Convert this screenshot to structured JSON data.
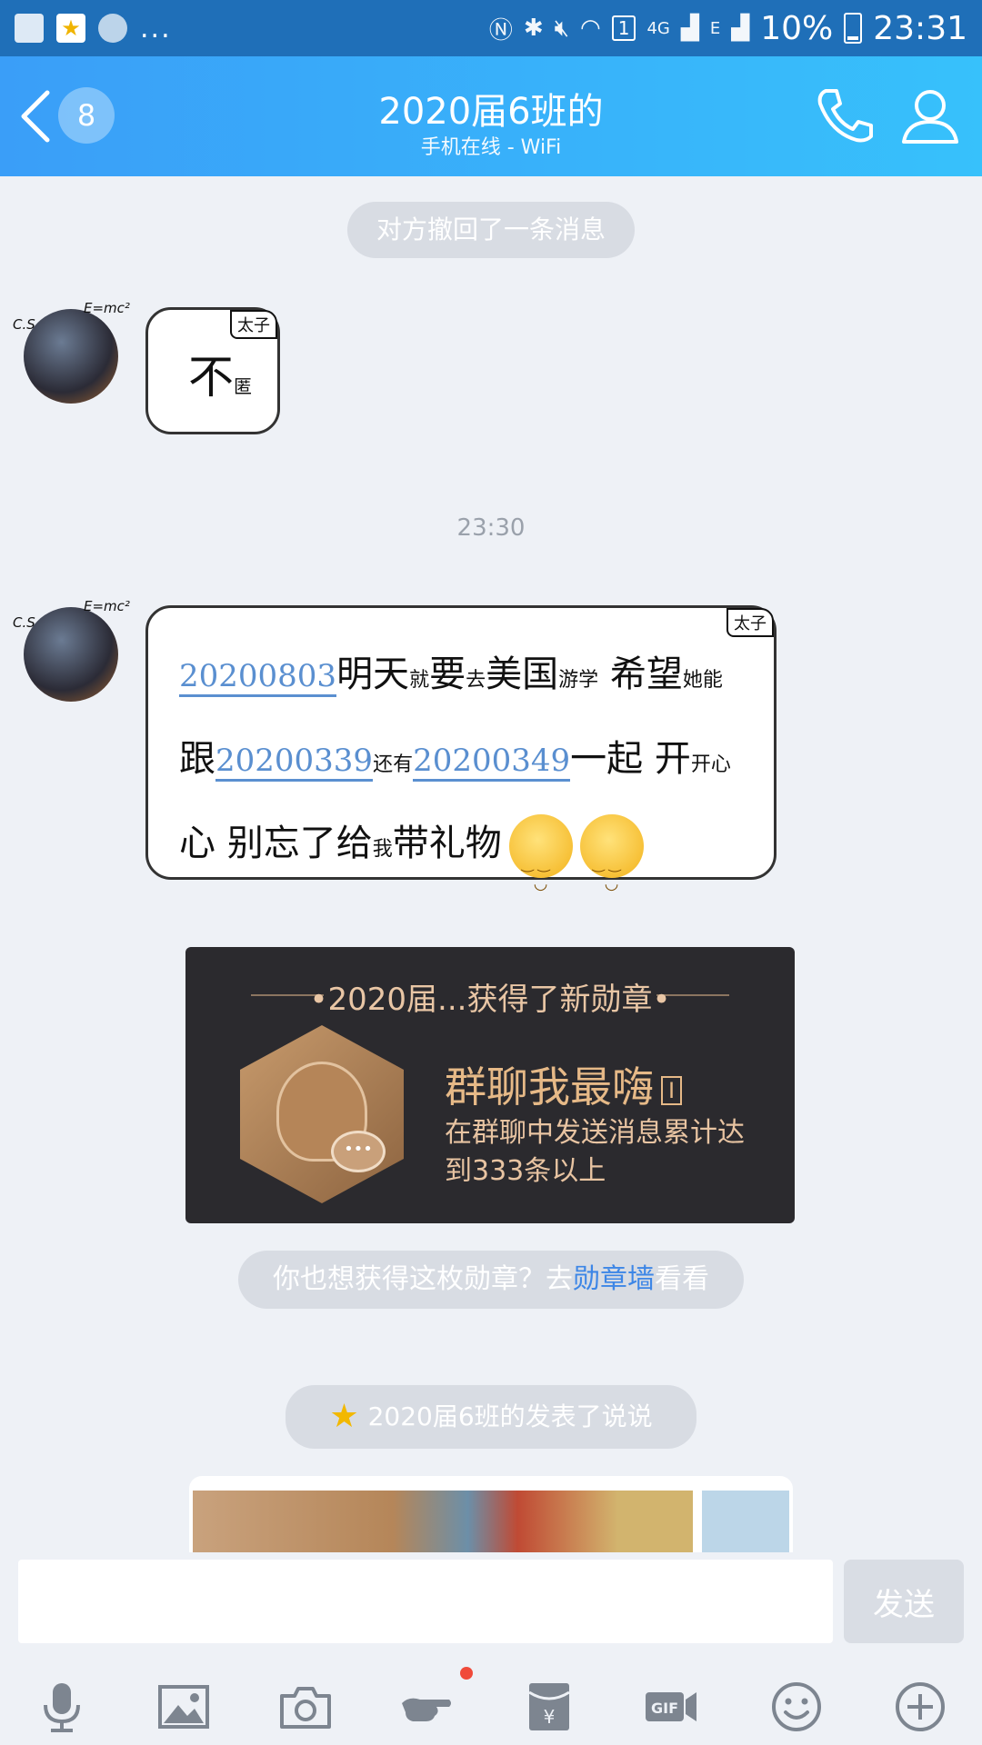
{
  "status_bar": {
    "network_4g": "4G",
    "network_e": "E",
    "sim_slot": "1",
    "battery": "10%",
    "time": "23:31",
    "ellipsis": "..."
  },
  "header": {
    "back_count": "8",
    "title": "2020届6班的",
    "subtitle": "手机在线 - WiFi"
  },
  "chat": {
    "recall_notice": "对方撤回了一条消息",
    "time_divider": "23:30",
    "messages": [
      {
        "sender_tag": "太子",
        "text_main": "不",
        "text_small": "匿"
      },
      {
        "sender_tag": "太子",
        "parts": {
          "num1": "20200803",
          "t1": "明天",
          "t1s": "就",
          "t2": "要",
          "t2s": "去",
          "t3": "美国",
          "t3s": "游学",
          "t4": "希望",
          "t4s": "她能",
          "t5": "跟",
          "num2": "20200339",
          "t5s": "还有",
          "num3": "20200349",
          "t6": "一起",
          "t7": "开",
          "t7s": "开心",
          "t8": "心 别忘了",
          "t9": "给",
          "t9s": "我",
          "t10": "带礼物"
        }
      }
    ]
  },
  "medal_card": {
    "heading": "2020届...获得了新勋章",
    "name": "群聊我最嗨",
    "level": "I",
    "description": "在群聊中发送消息累计达到333条以上"
  },
  "medal_wall_prompt": {
    "prefix": "你也想获得这枚勋章？去",
    "link": "勋章墙",
    "suffix": "看看"
  },
  "post_notice": "2020届6班的发表了说说",
  "input_bar": {
    "send_label": "发送",
    "tools": [
      "mic-icon",
      "image-icon",
      "camera-icon",
      "poke-icon",
      "red-packet-icon",
      "gif-icon",
      "emoji-icon",
      "plus-icon"
    ]
  },
  "colors": {
    "header_start": "#3a9ef8",
    "header_end": "#37c1fb",
    "link": "#3d86e6",
    "medal_bg": "#2b2a2e"
  }
}
